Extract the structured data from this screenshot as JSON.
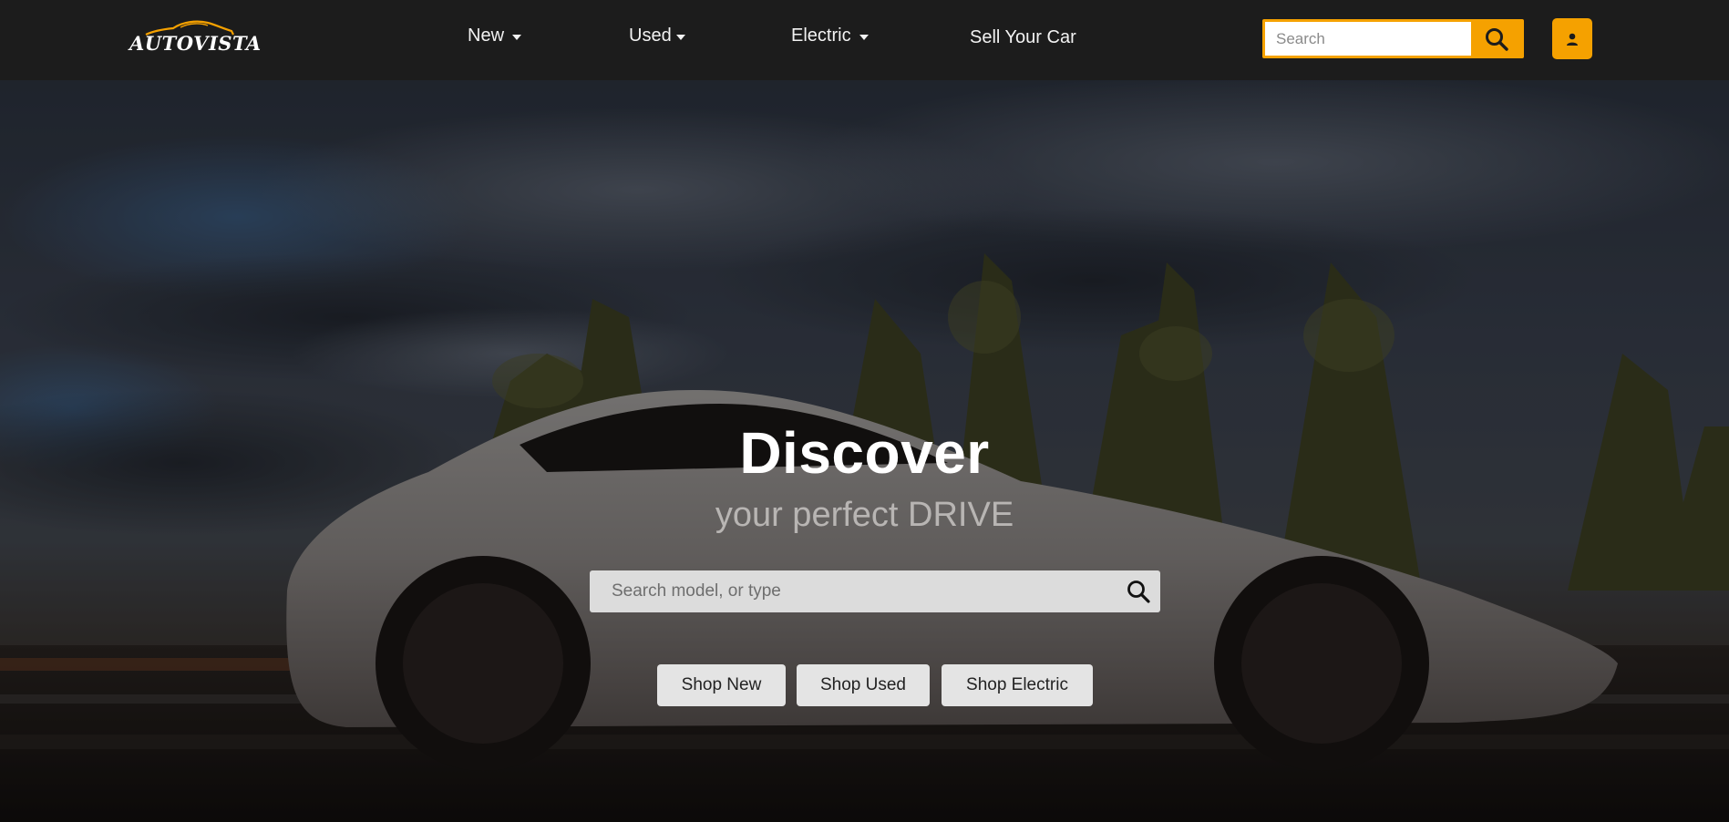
{
  "brand": {
    "name": "AUTOVISTA",
    "accent": "#f5a100"
  },
  "nav": {
    "items": [
      {
        "label": "New",
        "has_dropdown": true
      },
      {
        "label": "Used",
        "has_dropdown": true
      },
      {
        "label": "Electric",
        "has_dropdown": true
      },
      {
        "label": "Sell Your Car",
        "has_dropdown": false
      }
    ],
    "search": {
      "placeholder": "Search",
      "value": "",
      "icon": "search-icon"
    },
    "account": {
      "icon": "user-icon"
    }
  },
  "hero": {
    "title": "Discover",
    "subtitle": "your perfect DRIVE",
    "search": {
      "placeholder": "Search model, or type",
      "value": "",
      "icon": "search-icon"
    },
    "buttons": [
      {
        "label": "Shop New"
      },
      {
        "label": "Shop Used"
      },
      {
        "label": "Shop Electric"
      }
    ]
  },
  "colors": {
    "header_bg": "#1c1c1c",
    "accent": "#f5a100",
    "text_light": "#ffffff"
  }
}
